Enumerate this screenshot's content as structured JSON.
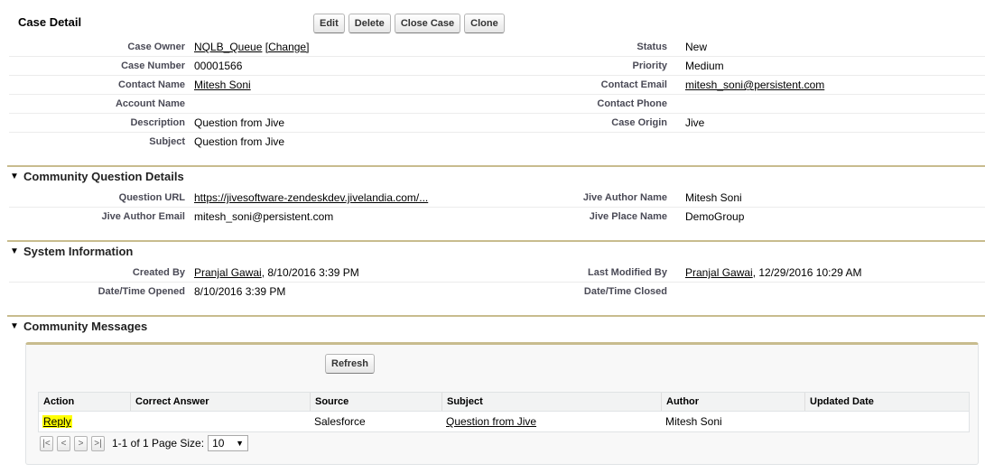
{
  "header": {
    "title": "Case Detail",
    "buttons": [
      "Edit",
      "Delete",
      "Close Case",
      "Clone"
    ]
  },
  "case_detail": {
    "case_owner_label": "Case Owner",
    "case_owner": "NQLB_Queue",
    "change_link": "[Change]",
    "status_label": "Status",
    "status": "New",
    "case_number_label": "Case Number",
    "case_number": "00001566",
    "priority_label": "Priority",
    "priority": "Medium",
    "contact_name_label": "Contact Name",
    "contact_name": "Mitesh Soni",
    "contact_email_label": "Contact Email",
    "contact_email": "mitesh_soni@persistent.com",
    "account_name_label": "Account Name",
    "contact_phone_label": "Contact Phone",
    "description_label": "Description",
    "description": "Question from Jive",
    "case_origin_label": "Case Origin",
    "case_origin": "Jive",
    "subject_label": "Subject",
    "subject": "Question from Jive"
  },
  "community_question": {
    "section_title": "Community Question Details",
    "question_url_label": "Question URL",
    "question_url": "https://jivesoftware-zendeskdev.jivelandia.com/...",
    "jive_author_name_label": "Jive Author Name",
    "jive_author_name": "Mitesh Soni",
    "jive_author_email_label": "Jive Author Email",
    "jive_author_email": "mitesh_soni@persistent.com",
    "jive_place_name_label": "Jive Place Name",
    "jive_place_name": "DemoGroup"
  },
  "system_info": {
    "section_title": "System Information",
    "created_by_label": "Created By",
    "created_by_user": "Pranjal Gawai",
    "created_by_date": ", 8/10/2016 3:39 PM",
    "last_modified_label": "Last Modified By",
    "last_modified_user": "Pranjal Gawai",
    "last_modified_date": ", 12/29/2016 10:29 AM",
    "opened_label": "Date/Time Opened",
    "opened": "8/10/2016 3:39 PM",
    "closed_label": "Date/Time Closed"
  },
  "community_messages": {
    "section_title": "Community Messages",
    "refresh_label": "Refresh",
    "columns": [
      "Action",
      "Correct Answer",
      "Source",
      "Subject",
      "Author",
      "Updated Date"
    ],
    "rows": [
      {
        "action": "Reply",
        "correct_answer": "",
        "source": "Salesforce",
        "subject": "Question from Jive",
        "author": "Mitesh Soni",
        "updated_date": ""
      }
    ],
    "pager": {
      "first": "|<",
      "prev": "<",
      "next": ">",
      "last": ">|",
      "summary": "1-1 of 1 Page Size:",
      "page_size": "10"
    }
  }
}
